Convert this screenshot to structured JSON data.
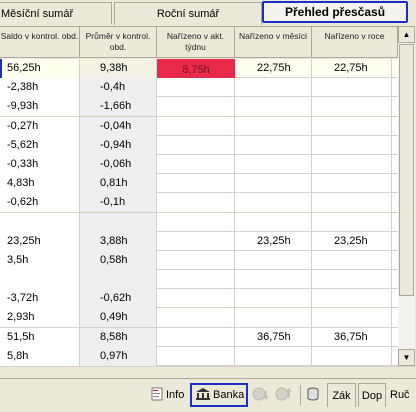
{
  "tabs": {
    "monthly": "Měsíční sumář",
    "yearly": "Roční sumář",
    "overtime": "Přehled přesčasů"
  },
  "columns": [
    "Saldo v kontrol. obd.",
    "Průměr v kontrol. obd.",
    "Nařízeno v akt. týdnu",
    "Nařízeno v měsíci",
    "Nařízeno v roce"
  ],
  "rows": [
    [
      "56,25h",
      "9,38h",
      "8,75h",
      "22,75h",
      "22,75h"
    ],
    [
      "-2,38h",
      "-0,4h",
      "",
      "",
      ""
    ],
    [
      "-9,93h",
      "-1,66h",
      "",
      "",
      ""
    ],
    [
      "-0,27h",
      "-0,04h",
      "",
      "",
      ""
    ],
    [
      "-5,62h",
      "-0,94h",
      "",
      "",
      ""
    ],
    [
      "-0,33h",
      "-0,06h",
      "",
      "",
      ""
    ],
    [
      "4,83h",
      "0,81h",
      "",
      "",
      ""
    ],
    [
      "-0,62h",
      "-0,1h",
      "",
      "",
      ""
    ],
    [
      "",
      "",
      "",
      "",
      ""
    ],
    [
      "23,25h",
      "3,88h",
      "",
      "23,25h",
      "23,25h"
    ],
    [
      "3,5h",
      "0,58h",
      "",
      "",
      ""
    ],
    [
      "",
      "",
      "",
      "",
      ""
    ],
    [
      "-3,72h",
      "-0,62h",
      "",
      "",
      ""
    ],
    [
      "2,93h",
      "0,49h",
      "",
      "",
      ""
    ],
    [
      "51,5h",
      "8,58h",
      "",
      "36,75h",
      "36,75h"
    ],
    [
      "5,8h",
      "0,97h",
      "",
      "",
      ""
    ]
  ],
  "toolbar": {
    "info": "Info",
    "bank": "Banka",
    "zak": "Zák",
    "dop": "Dop",
    "ruc": "Ruč"
  },
  "colors": {
    "selection_border": "#1a2fc7",
    "highlight": "#e8294a"
  }
}
